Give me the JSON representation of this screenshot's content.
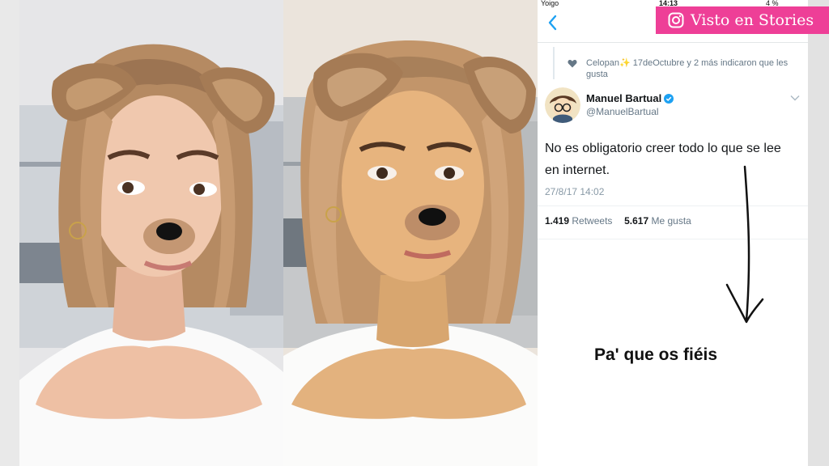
{
  "badge": {
    "icon": "instagram-icon",
    "label": "Visto en Stories",
    "color": "#ee3f97"
  },
  "photos": [
    {
      "description": "selfie-dog-filter-left",
      "filter": "dog-ears-and-nose"
    },
    {
      "description": "selfie-dog-filter-middle",
      "filter": "dog-ears-and-nose"
    }
  ],
  "phone": {
    "status_bar": {
      "carrier": "Yoigo",
      "time": "14:13",
      "battery": "4 %"
    },
    "nav": {
      "back_icon": "chevron-left-icon"
    },
    "activity": {
      "icon": "heart-icon",
      "text": "Celopan✨ 17deOctubre y 2 más indicaron que les gusta"
    },
    "tweet": {
      "author_name": "Manuel Bartual",
      "handle": "@ManuelBartual",
      "verified": true,
      "text": "No es obligatorio creer todo lo que se lee en internet.",
      "timestamp": "27/8/17 14:02",
      "retweets_count": "1.419",
      "retweets_label": "Retweets",
      "likes_count": "5.617",
      "likes_label": "Me gusta"
    },
    "annotation": {
      "arrow": "hand-drawn-arrow-down",
      "caption": "Pa' que os fiéis"
    },
    "colors": {
      "accent": "#1da1f2",
      "text": "#14171a",
      "secondary": "#657786"
    }
  }
}
